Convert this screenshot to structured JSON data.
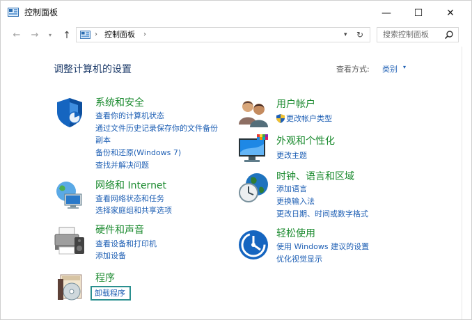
{
  "window": {
    "title": "控制面板"
  },
  "controls": {
    "minimize": "—",
    "maximize": "☐",
    "close": "✕"
  },
  "nav": {
    "back": "←",
    "forward": "→",
    "dropdown": "▾",
    "up": "↑"
  },
  "address": {
    "sep": "›",
    "path": "控制面板",
    "dropdown": "▾",
    "refresh": "↻"
  },
  "search": {
    "placeholder": "搜索控制面板"
  },
  "main": {
    "title": "调整计算机的设置",
    "view_by_label": "查看方式:",
    "view_by_value": "类别",
    "view_by_caret": "▾"
  },
  "categories": {
    "system": {
      "title": "系统和安全",
      "links": [
        "查看你的计算机状态",
        "通过文件历史记录保存你的文件备份",
        "副本",
        "备份和还原(Windows 7)",
        "查找并解决问题"
      ]
    },
    "network": {
      "title": "网络和 Internet",
      "links": [
        "查看网络状态和任务",
        "选择家庭组和共享选项"
      ]
    },
    "hardware": {
      "title": "硬件和声音",
      "links": [
        "查看设备和打印机",
        "添加设备"
      ]
    },
    "programs": {
      "title": "程序",
      "links": [
        "卸载程序"
      ]
    },
    "users": {
      "title": "用户帐户",
      "links": [
        "更改帐户类型"
      ]
    },
    "appearance": {
      "title": "外观和个性化",
      "links": [
        "更改主题"
      ]
    },
    "clock": {
      "title": "时钟、语言和区域",
      "links": [
        "添加语言",
        "更换输入法",
        "更改日期、时间或数字格式"
      ]
    },
    "ease": {
      "title": "轻松使用",
      "links": [
        "使用 Windows 建议的设置",
        "优化视觉显示"
      ]
    }
  },
  "colors": {
    "category_title": "#1a8a2e",
    "link": "#1e5fb4",
    "highlight_box": "#2a8f8f"
  }
}
